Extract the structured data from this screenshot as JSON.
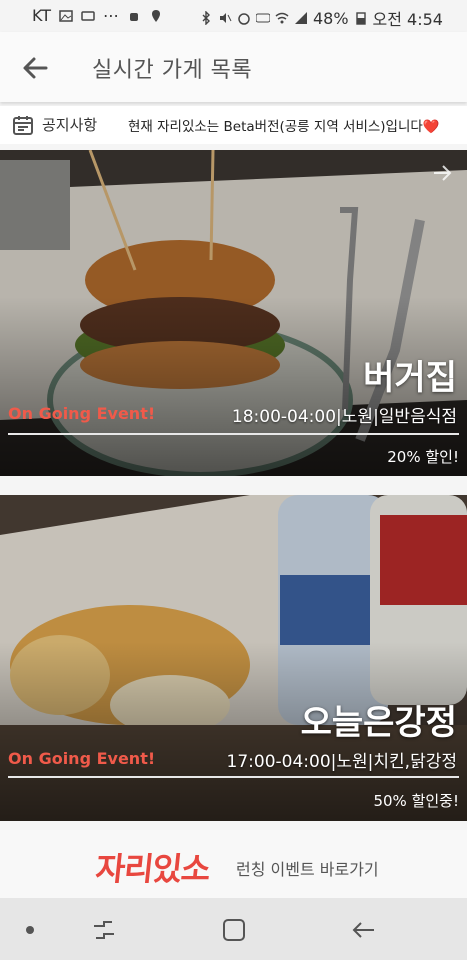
{
  "status_bar": {
    "carrier": "KT",
    "battery": "48%",
    "time": "오전 4:54"
  },
  "app_bar": {
    "title": "실시간 가게 목록"
  },
  "notice": {
    "label": "공지사항",
    "text": "현재 자리있소는 Beta버전(공릉 지역 서비스)입니다❤️"
  },
  "stores": [
    {
      "name": "버거집",
      "event": "On Going Event!",
      "hours": "18:00-04:00",
      "area": "노원",
      "category": "일반음식점",
      "discount": "20% 할인!"
    },
    {
      "name": "오늘은강정",
      "event": "On Going Event!",
      "hours": "17:00-04:00",
      "area": "노원",
      "category": "치킨,닭강정",
      "discount": "50% 할인중!"
    }
  ],
  "banner": {
    "logo": "자리있소",
    "text": "런칭 이벤트 바로가기"
  },
  "colors": {
    "accent": "#e8473f",
    "event": "#f05a4a"
  }
}
